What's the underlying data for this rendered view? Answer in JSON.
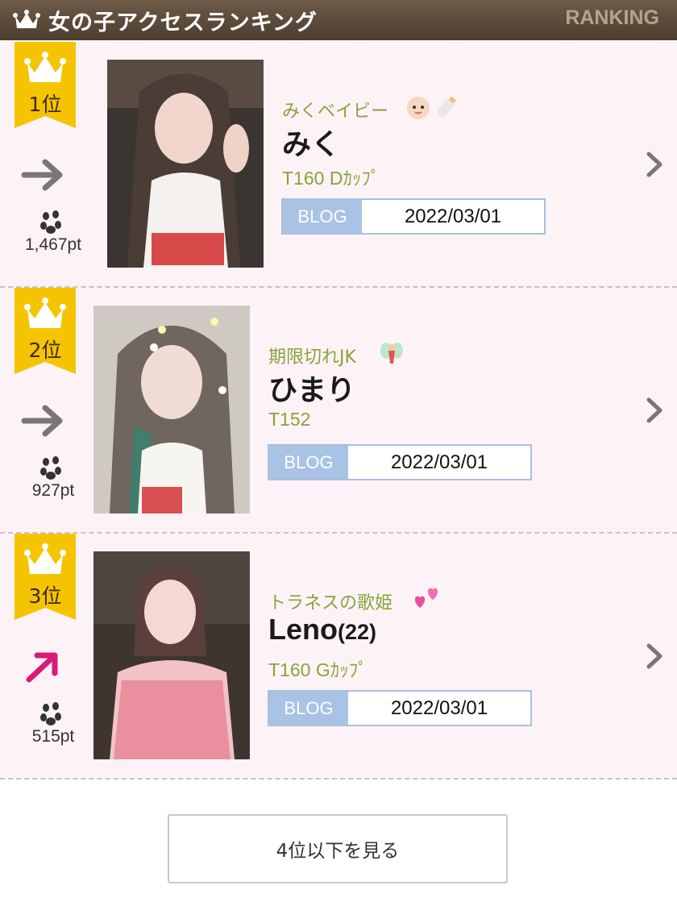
{
  "header": {
    "title": "女の子アクセスランキング",
    "sub": "RANKING",
    "icon": "crown-icon"
  },
  "ranking": [
    {
      "rank": "1位",
      "trend": "arrow-right",
      "points": "1,467pt",
      "catch": "みくベイビー",
      "name": "みく",
      "age": "",
      "spec": "T160 Dｶｯﾌﾟ",
      "blog_label": "BLOG",
      "date": "2022/03/01"
    },
    {
      "rank": "2位",
      "trend": "arrow-right",
      "points": "927pt",
      "catch": "期限切れJK",
      "name": "ひまり",
      "age": "",
      "spec": "T152",
      "blog_label": "BLOG",
      "date": "2022/03/01"
    },
    {
      "rank": "3位",
      "trend": "arrow-up-right",
      "points": "515pt",
      "catch": "トラネスの歌姫",
      "name": "Leno",
      "age": "(22)",
      "spec": "T160 Gｶｯﾌﾟ",
      "blog_label": "BLOG",
      "date": "2022/03/01"
    }
  ],
  "more_button": {
    "label": "4位以下を見る"
  },
  "colors": {
    "header": "#5c4a39",
    "accent_green": "#88a43b",
    "badge_gold": "#f5c400",
    "blog_blue": "#a9c3e6",
    "trend_up": "#d81b77"
  }
}
